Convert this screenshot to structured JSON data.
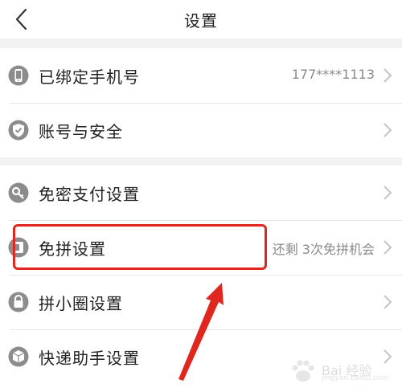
{
  "header": {
    "title": "设置"
  },
  "group1": [
    {
      "label": "已绑定手机号",
      "value": "177****1113",
      "icon": "phone-icon"
    },
    {
      "label": "账号与安全",
      "value": "",
      "icon": "shield-icon"
    }
  ],
  "group2": [
    {
      "label": "免密支付设置",
      "value": "",
      "icon": "key-icon"
    },
    {
      "label": "免拼设置",
      "value": "还剩 3次免拼机会",
      "icon": "card-icon"
    },
    {
      "label": "拼小圈设置",
      "value": "",
      "icon": "lock-icon"
    },
    {
      "label": "快递助手设置",
      "value": "",
      "icon": "package-icon"
    }
  ],
  "watermark": {
    "text": "Bai 经验",
    "sub": "jingyan.baidu.com"
  },
  "colors": {
    "accent_red": "#e0271f",
    "icon_gray": "#8c8c8c"
  }
}
